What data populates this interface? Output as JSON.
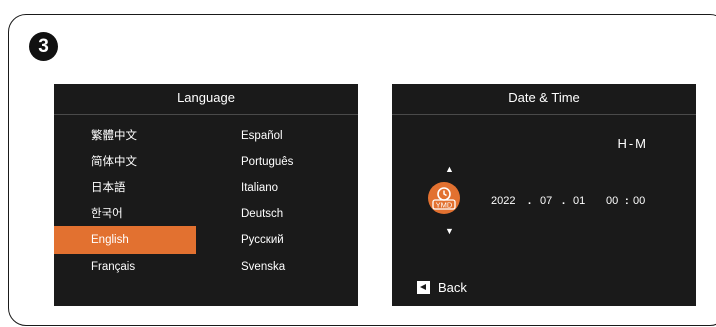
{
  "step_number": "3",
  "language_panel": {
    "title": "Language",
    "left_column": [
      "繁體中文",
      "简体中文",
      "日本語",
      "한국어",
      "English",
      "Français"
    ],
    "right_column": [
      "Español",
      "Português",
      "Italiano",
      "Deutsch",
      "Русский",
      "Svenska"
    ],
    "selected": "English"
  },
  "datetime_panel": {
    "title": "Date & Time",
    "format_label": "H-M",
    "icon_label": "YMD",
    "date": {
      "year": "2022",
      "sep1": ".",
      "month": "07",
      "sep2": ".",
      "day": "01"
    },
    "time": {
      "hour": "00",
      "colon": ":",
      "minute": "00"
    },
    "back_label": "Back"
  },
  "colors": {
    "accent": "#e27130",
    "panel": "#1a1a1a"
  },
  "icons": [
    "up-arrow-icon",
    "down-arrow-icon",
    "clock-ymd-icon",
    "back-arrow-icon"
  ]
}
